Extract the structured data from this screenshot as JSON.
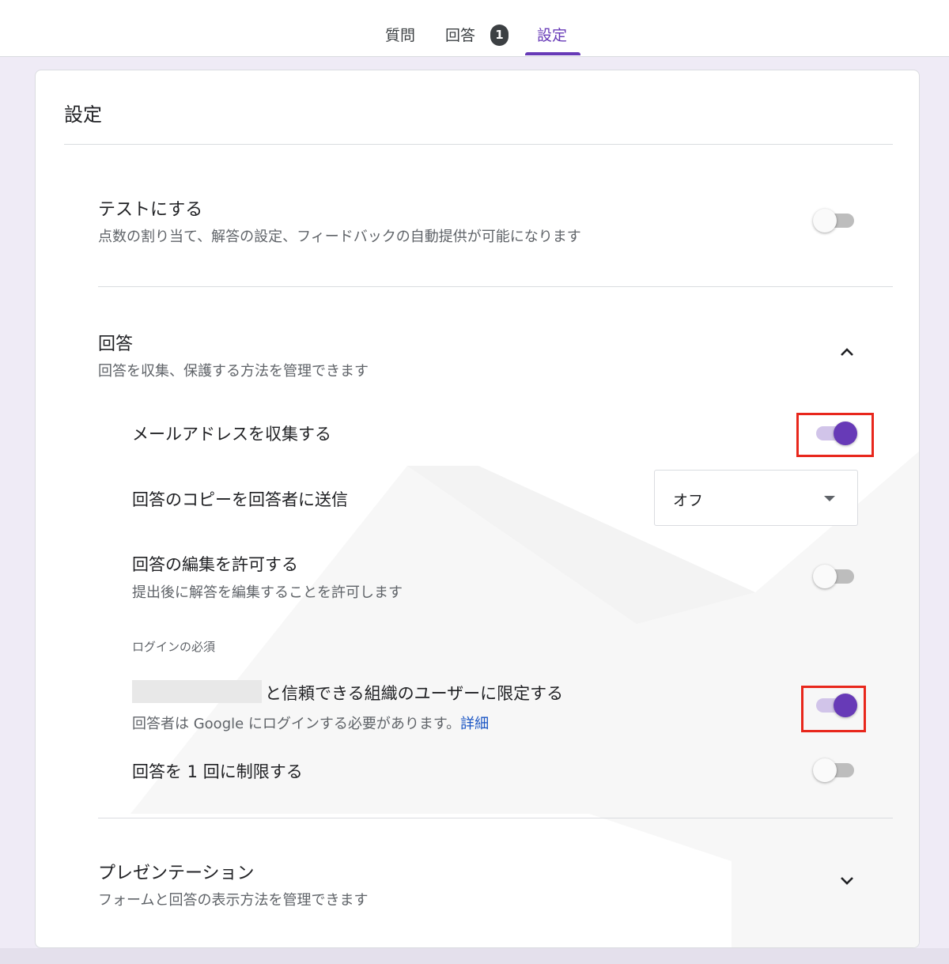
{
  "tabs": [
    {
      "label": "質問",
      "active": false
    },
    {
      "label": "回答",
      "active": false,
      "badge": "1"
    },
    {
      "label": "設定",
      "active": true
    }
  ],
  "card": {
    "title": "設定"
  },
  "quiz": {
    "title": "テストにする",
    "description": "点数の割り当て、解答の設定、フィードバックの自動提供が可能になります",
    "enabled": false
  },
  "responses": {
    "title": "回答",
    "description": "回答を収集、保護する方法を管理できます",
    "expanded": true,
    "collect_email": {
      "label": "メールアドレスを収集する",
      "enabled": true
    },
    "send_copy": {
      "label": "回答のコピーを回答者に送信",
      "selected": "オフ"
    },
    "allow_edit": {
      "label": "回答の編集を許可する",
      "description": "提出後に解答を編集することを許可します",
      "enabled": false
    },
    "login_required_label": "ログインの必須",
    "restrict_org": {
      "label": "と信頼できる組織のユーザーに限定する",
      "description": "回答者は Google にログインする必要があります。",
      "link": "詳細",
      "enabled": true
    },
    "limit_one": {
      "label": "回答を 1 回に制限する",
      "enabled": false
    }
  },
  "presentation": {
    "title": "プレゼンテーション",
    "description": "フォームと回答の表示方法を管理できます",
    "expanded": false
  },
  "colors": {
    "accent": "#673ab7",
    "highlight": "#e8271c",
    "link": "#1a55c4"
  }
}
